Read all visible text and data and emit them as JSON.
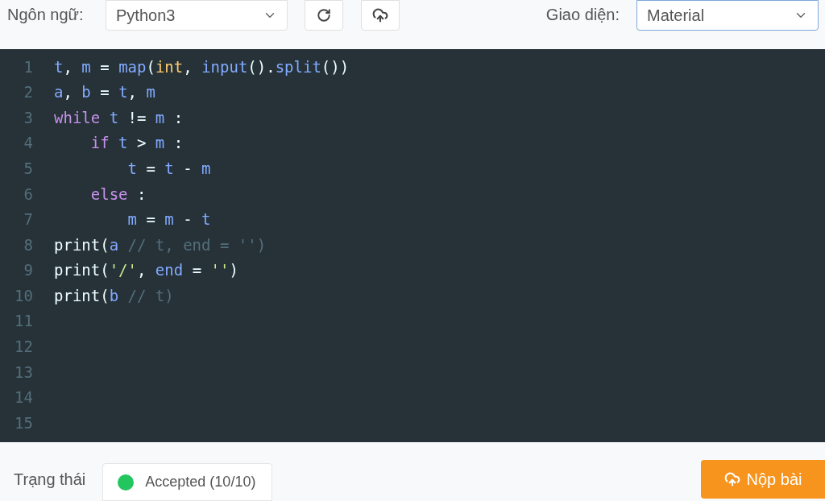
{
  "toolbar": {
    "language_label": "Ngôn ngữ:",
    "language_select": {
      "value": "Python3",
      "focused": false
    },
    "theme_label": "Giao diện:",
    "theme_select": {
      "value": "Material",
      "focused": true
    }
  },
  "editor": {
    "lines": [
      {
        "number": "1",
        "tokens": [
          {
            "text": "t",
            "kind": "name"
          },
          {
            "text": ", ",
            "kind": "punct"
          },
          {
            "text": "m",
            "kind": "name"
          },
          {
            "text": " = ",
            "kind": "punct"
          },
          {
            "text": "map",
            "kind": "call"
          },
          {
            "text": "(",
            "kind": "punct"
          },
          {
            "text": "int",
            "kind": "type"
          },
          {
            "text": ", ",
            "kind": "punct"
          },
          {
            "text": "input",
            "kind": "call"
          },
          {
            "text": "().",
            "kind": "punct"
          },
          {
            "text": "split",
            "kind": "call"
          },
          {
            "text": "())",
            "kind": "punct"
          }
        ]
      },
      {
        "number": "2",
        "tokens": [
          {
            "text": "a",
            "kind": "name"
          },
          {
            "text": ", ",
            "kind": "punct"
          },
          {
            "text": "b",
            "kind": "name"
          },
          {
            "text": " = ",
            "kind": "punct"
          },
          {
            "text": "t",
            "kind": "name"
          },
          {
            "text": ", ",
            "kind": "punct"
          },
          {
            "text": "m",
            "kind": "name"
          }
        ]
      },
      {
        "number": "3",
        "tokens": [
          {
            "text": "while",
            "kind": "keyword"
          },
          {
            "text": " t",
            "kind": "name"
          },
          {
            "text": " != ",
            "kind": "punct"
          },
          {
            "text": "m",
            "kind": "name"
          },
          {
            "text": " :",
            "kind": "punct"
          }
        ]
      },
      {
        "number": "4",
        "tokens": [
          {
            "text": "    if",
            "kind": "keyword"
          },
          {
            "text": " t",
            "kind": "name"
          },
          {
            "text": " > ",
            "kind": "punct"
          },
          {
            "text": "m",
            "kind": "name"
          },
          {
            "text": " :",
            "kind": "punct"
          }
        ]
      },
      {
        "number": "5",
        "tokens": [
          {
            "text": "        t",
            "kind": "name"
          },
          {
            "text": " = ",
            "kind": "punct"
          },
          {
            "text": "t",
            "kind": "name"
          },
          {
            "text": " - ",
            "kind": "punct"
          },
          {
            "text": "m",
            "kind": "name"
          }
        ]
      },
      {
        "number": "6",
        "tokens": [
          {
            "text": "    else",
            "kind": "keyword"
          },
          {
            "text": " :",
            "kind": "punct"
          }
        ]
      },
      {
        "number": "7",
        "tokens": [
          {
            "text": "        m",
            "kind": "name"
          },
          {
            "text": " = ",
            "kind": "punct"
          },
          {
            "text": "m",
            "kind": "name"
          },
          {
            "text": " - ",
            "kind": "punct"
          },
          {
            "text": "t",
            "kind": "name"
          }
        ]
      },
      {
        "number": "8",
        "tokens": [
          {
            "text": "print(",
            "kind": "punct"
          },
          {
            "text": "a",
            "kind": "name"
          },
          {
            "text": " // t, end = '')",
            "kind": "comment"
          }
        ]
      },
      {
        "number": "9",
        "tokens": [
          {
            "text": "print(",
            "kind": "punct"
          },
          {
            "text": "'/'",
            "kind": "string"
          },
          {
            "text": ", ",
            "kind": "punct"
          },
          {
            "text": "end",
            "kind": "name"
          },
          {
            "text": " = ",
            "kind": "punct"
          },
          {
            "text": "''",
            "kind": "string"
          },
          {
            "text": ")",
            "kind": "punct"
          }
        ]
      },
      {
        "number": "10",
        "tokens": [
          {
            "text": "print(",
            "kind": "punct"
          },
          {
            "text": "b",
            "kind": "name"
          },
          {
            "text": " // t)",
            "kind": "comment"
          }
        ]
      },
      {
        "number": "11"
      },
      {
        "number": "12"
      },
      {
        "number": "13"
      },
      {
        "number": "14"
      },
      {
        "number": "15"
      }
    ]
  },
  "footer": {
    "status_label": "Trạng thái",
    "status": {
      "text": "Accepted (10/10)",
      "color": "#22c55e"
    },
    "submit_button": "Nộp bài"
  }
}
